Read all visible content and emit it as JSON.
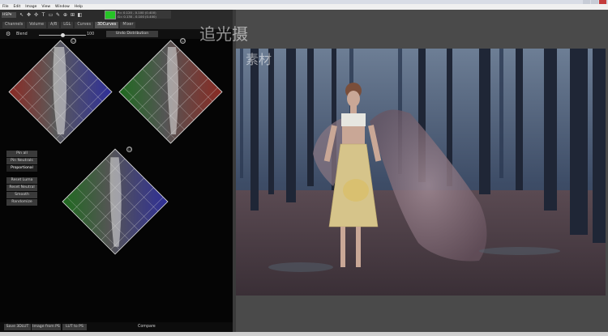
{
  "window": {
    "menu": [
      "File",
      "Edit",
      "Image",
      "View",
      "Window",
      "Help"
    ]
  },
  "toolbar": {
    "mode_select": "HSP▾",
    "swatch_color": "#26c426",
    "readout_line1": "R= 0.120 - 0.100 (0.400)",
    "readout_line2": "G= 0.130 - 0.100 (0.400)"
  },
  "tabs": [
    "Channels",
    "Volume",
    "A/B",
    "LGL",
    "Curves",
    "3DCurves",
    "Mixer"
  ],
  "options": {
    "blend_label": "Blend",
    "blend_value": "100",
    "blend_level": 0.5,
    "undo_label": "Undo Distribution"
  },
  "buttons": [
    "Pin all",
    "Pin Neutrals",
    "Proportional",
    "Reset Luma",
    "Reset Neutral",
    "Smooth",
    "Randomize"
  ],
  "bottom": {
    "save_3dlut": "Save 3DLUT",
    "image_from_ps": "Image from PS",
    "lut_in_ps": "LUT to PS",
    "compare": "Compare"
  },
  "watermark": {
    "line1": "追光摄",
    "line2": "素材"
  },
  "colors": {
    "panel": "#050505",
    "right_bg": "#4a4a4a",
    "accent": "#26c426"
  }
}
